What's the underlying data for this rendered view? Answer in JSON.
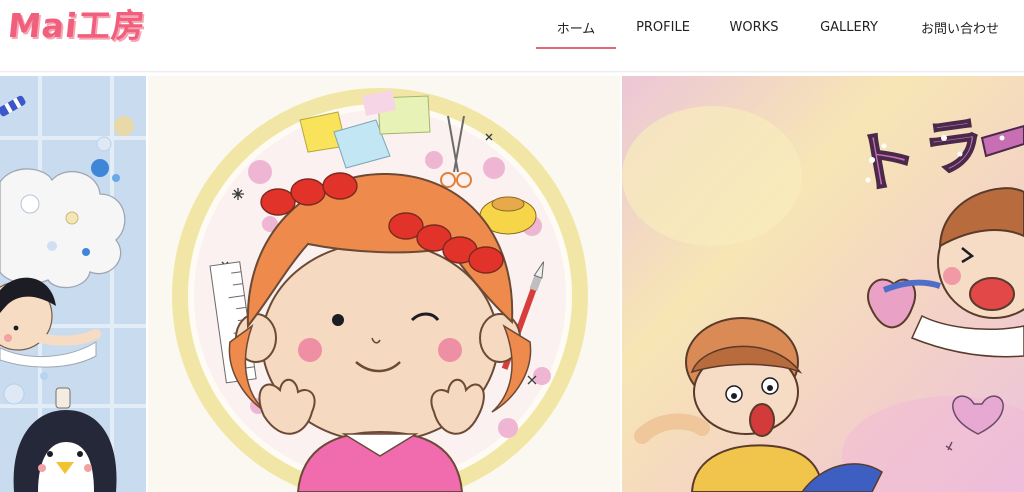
{
  "site": {
    "logo_text": "Mai工房"
  },
  "nav": {
    "items": [
      {
        "label": "ホーム",
        "active": true
      },
      {
        "label": "PROFILE",
        "active": false
      },
      {
        "label": "WORKS",
        "active": false
      },
      {
        "label": "GALLERY",
        "active": false
      },
      {
        "label": "お問い合わせ",
        "active": false
      }
    ]
  },
  "hero": {
    "slides": [
      {
        "subject": "girl-penguin-bubbles-illustration"
      },
      {
        "subject": "girl-portrait-wreath-illustration"
      },
      {
        "subject": "boys-tug-of-war-illustration",
        "visible_text": "トラ"
      }
    ]
  },
  "colors": {
    "accent_pink": "#f05f7b",
    "active_underline": "#e06a74",
    "nav_text": "#222222"
  }
}
